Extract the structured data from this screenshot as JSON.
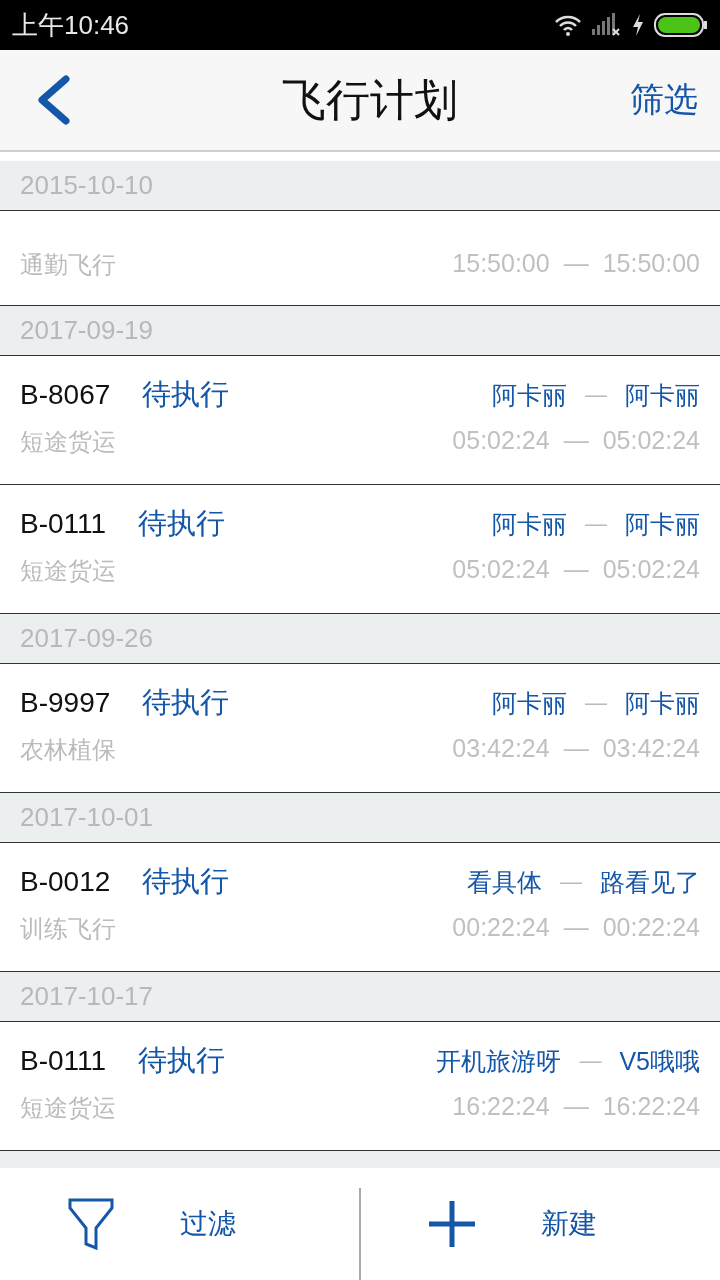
{
  "status_bar": {
    "time": "上午10:46"
  },
  "header": {
    "title": "飞行计划",
    "action": "筛选"
  },
  "sections": [
    {
      "date": "2015-10-10",
      "flights": [
        {
          "type": "通勤飞行",
          "start": "15:50:00",
          "end": "15:50:00"
        }
      ]
    },
    {
      "date": "2017-09-19",
      "flights": [
        {
          "code": "B-8067",
          "status": "待执行",
          "type": "短途货运",
          "from": "阿卡丽",
          "to": "阿卡丽",
          "start": "05:02:24",
          "end": "05:02:24"
        },
        {
          "code": "B-0111",
          "status": "待执行",
          "type": "短途货运",
          "from": "阿卡丽",
          "to": "阿卡丽",
          "start": "05:02:24",
          "end": "05:02:24"
        }
      ]
    },
    {
      "date": "2017-09-26",
      "flights": [
        {
          "code": "B-9997",
          "status": "待执行",
          "type": "农林植保",
          "from": "阿卡丽",
          "to": "阿卡丽",
          "start": "03:42:24",
          "end": "03:42:24"
        }
      ]
    },
    {
      "date": "2017-10-01",
      "flights": [
        {
          "code": "B-0012",
          "status": "待执行",
          "type": "训练飞行",
          "from": "看具体",
          "to": "路看见了",
          "start": "00:22:24",
          "end": "00:22:24"
        }
      ]
    },
    {
      "date": "2017-10-17",
      "flights": [
        {
          "code": "B-0111",
          "status": "待执行",
          "type": "短途货运",
          "from": "开机旅游呀",
          "to": "V5哦哦",
          "start": "16:22:24",
          "end": "16:22:24"
        }
      ]
    }
  ],
  "separator": "—",
  "bottom_bar": [
    {
      "kind": "filter",
      "label": "过滤"
    },
    {
      "kind": "add",
      "label": "新建"
    }
  ]
}
